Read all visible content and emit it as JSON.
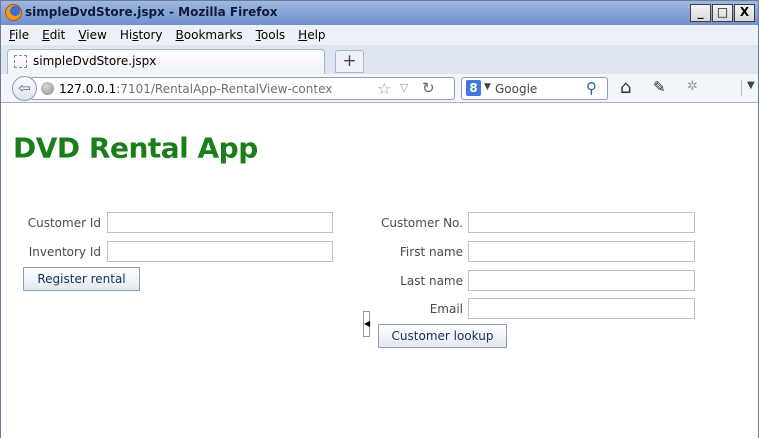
{
  "window": {
    "title": "simpleDvdStore.jspx - Mozilla Firefox",
    "controls": {
      "minimize": "_",
      "maximize": "□",
      "close": "X"
    }
  },
  "menubar": {
    "items": [
      {
        "label": "File",
        "accel": "F",
        "rest": "ile"
      },
      {
        "label": "Edit",
        "accel": "E",
        "rest": "dit"
      },
      {
        "label": "View",
        "accel": "V",
        "rest": "iew"
      },
      {
        "label": "History",
        "pre": "Hi",
        "accel": "s",
        "rest": "tory"
      },
      {
        "label": "Bookmarks",
        "accel": "B",
        "rest": "ookmarks"
      },
      {
        "label": "Tools",
        "accel": "T",
        "rest": "ools"
      },
      {
        "label": "Help",
        "accel": "H",
        "rest": "elp"
      }
    ]
  },
  "tabs": [
    {
      "title": "simpleDvdStore.jspx"
    }
  ],
  "navbar": {
    "url_host": "127.0.0.1",
    "url_rest": ":7101/RentalApp-RentalView-contex",
    "search_placeholder": "Google",
    "search_engine_letter": "8",
    "icons": [
      "back-icon",
      "globe-icon",
      "star-icon",
      "dropmarker-icon",
      "reload-icon",
      "search-engine-icon",
      "search-go-icon",
      "home-icon",
      "tools-icon",
      "addon-icon",
      "menu-arrow-icon"
    ]
  },
  "page": {
    "title": "DVD Rental App",
    "title_color": "#1a7f1a",
    "rental_form": {
      "customer_id_label": "Customer Id",
      "customer_id_value": "",
      "inventory_id_label": "Inventory Id",
      "inventory_id_value": "",
      "register_button": "Register rental"
    },
    "customer_form": {
      "customer_no_label": "Customer No.",
      "customer_no_value": "",
      "first_name_label": "First name",
      "first_name_value": "",
      "last_name_label": "Last name",
      "last_name_value": "",
      "email_label": "Email",
      "email_value": "",
      "lookup_button": "Customer lookup"
    }
  }
}
